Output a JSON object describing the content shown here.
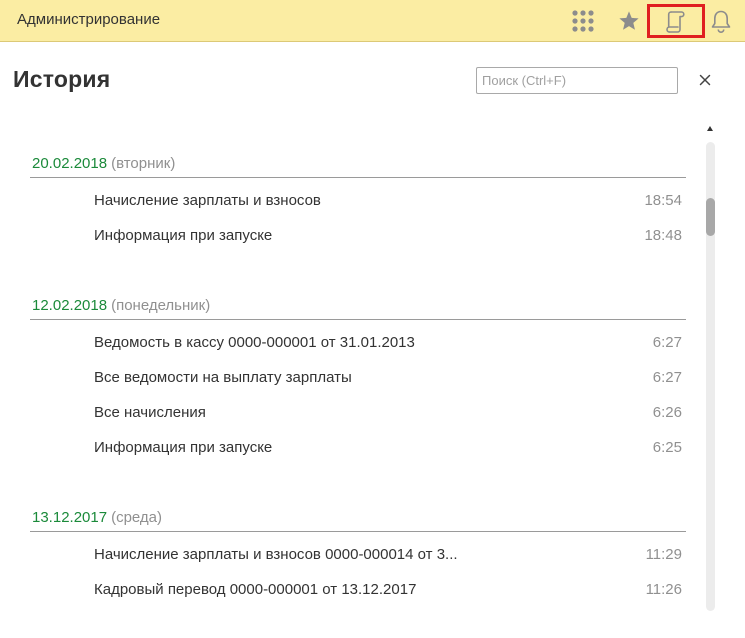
{
  "app": {
    "title": "Администрирование"
  },
  "toolbar": {
    "icons": [
      "apps-grid-icon",
      "star-icon",
      "history-icon",
      "bell-icon"
    ],
    "highlight_color": "#e02020"
  },
  "panel": {
    "title": "История",
    "search_placeholder": "Поиск (Ctrl+F)",
    "close_label": "×"
  },
  "groups": [
    {
      "date": "20.02.2018",
      "day": "(вторник)",
      "items": [
        {
          "title": "Начисление зарплаты и взносов",
          "time": "18:54"
        },
        {
          "title": "Информация при запуске",
          "time": "18:48"
        }
      ]
    },
    {
      "date": "12.02.2018",
      "day": "(понедельник)",
      "items": [
        {
          "title": "Ведомость в кассу 0000-000001 от 31.01.2013",
          "time": "6:27"
        },
        {
          "title": "Все ведомости на выплату зарплаты",
          "time": "6:27"
        },
        {
          "title": "Все начисления",
          "time": "6:26"
        },
        {
          "title": "Информация при запуске",
          "time": "6:25"
        }
      ]
    },
    {
      "date": "13.12.2017",
      "day": "(среда)",
      "items": [
        {
          "title": "Начисление зарплаты и взносов 0000-000014 от 3...",
          "time": "11:29"
        },
        {
          "title": "Кадровый перевод 0000-000001 от 13.12.2017",
          "time": "11:26"
        }
      ]
    }
  ],
  "colors": {
    "topbar": "#fbeda3",
    "date": "#1b8a3a",
    "muted": "#909090"
  }
}
